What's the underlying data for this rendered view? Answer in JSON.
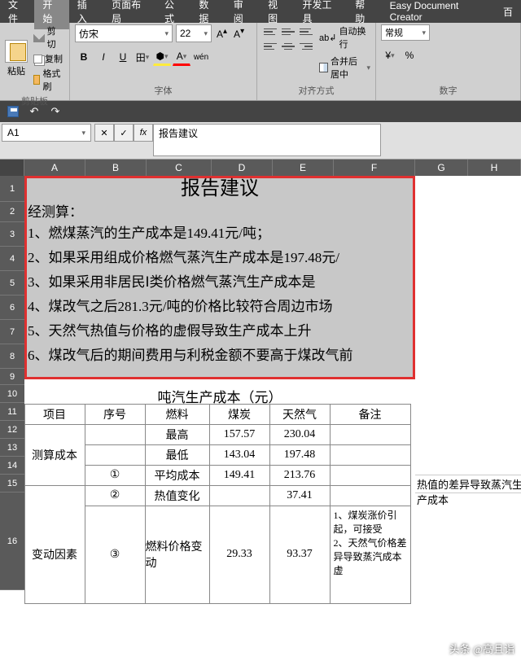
{
  "menu": {
    "file": "文件",
    "home": "开始",
    "insert": "插入",
    "layout": "页面布局",
    "formula": "公式",
    "data": "数据",
    "review": "审阅",
    "view": "视图",
    "dev": "开发工具",
    "help": "帮助",
    "edc": "Easy Document Creator",
    "baidu": "百"
  },
  "clipboard": {
    "paste": "粘贴",
    "cut": "剪切",
    "copy": "复制",
    "painter": "格式刷",
    "label": "剪贴板"
  },
  "font": {
    "name": "仿宋",
    "size": "22",
    "label": "字体",
    "bold": "B",
    "italic": "I",
    "underline": "U"
  },
  "align": {
    "wrap": "自动换行",
    "merge": "合并后居中",
    "label": "对齐方式"
  },
  "number": {
    "format": "常规",
    "label": "数字"
  },
  "namebox": "A1",
  "fx_value": "报告建议",
  "cols": [
    "A",
    "B",
    "C",
    "D",
    "E",
    "F",
    "G",
    "H"
  ],
  "rows": [
    "1",
    "2",
    "3",
    "4",
    "5",
    "6",
    "7",
    "8",
    "9",
    "10",
    "11",
    "12",
    "13",
    "14",
    "15",
    "16"
  ],
  "report": {
    "title": "报告建议",
    "intro": "经测算：",
    "l1": "1、燃煤蒸汽的生产成本是149.41元/吨；",
    "l2": "2、如果采用组成价格燃气蒸汽生产成本是197.48元/",
    "l3": "3、如果采用非居民Ⅰ类价格燃气蒸汽生产成本是",
    "l4": "4、煤改气之后281.3元/吨的价格比较符合周边市场",
    "l5": "5、天然气热值与价格的虚假导致生产成本上升",
    "l6": "6、煤改气后的期间费用与利税金额不要高于煤改气前"
  },
  "table2": {
    "title": "吨汽生产成本（元）",
    "headers": {
      "item": "项目",
      "no": "序号",
      "fuel": "燃料",
      "coal": "煤炭",
      "gas": "天然气",
      "note": "备注"
    },
    "r1": {
      "item": "",
      "no": "",
      "fuel": "最高",
      "coal": "157.57",
      "gas": "230.04",
      "note": ""
    },
    "r2": {
      "item": "测算成本",
      "no": "",
      "fuel": "最低",
      "coal": "143.04",
      "gas": "197.48",
      "note": ""
    },
    "r3": {
      "item": "",
      "no": "①",
      "fuel": "平均成本",
      "coal": "149.41",
      "gas": "213.76",
      "note": ""
    },
    "r4": {
      "item": "",
      "no": "②",
      "fuel": "热值变化",
      "coal": "",
      "gas": "37.41",
      "note": ""
    },
    "r5": {
      "item": "变动因素",
      "no": "③",
      "fuel": "燃料价格变动",
      "coal": "29.33",
      "gas": "93.37",
      "note": ""
    }
  },
  "extra": {
    "e1": "热值的差异导致蒸汽生产成本",
    "e2": "1、煤炭涨价引起，可接受",
    "e3": "2、天然气价格差异导致蒸汽成本虚"
  },
  "watermark": "头条 @高且诣"
}
